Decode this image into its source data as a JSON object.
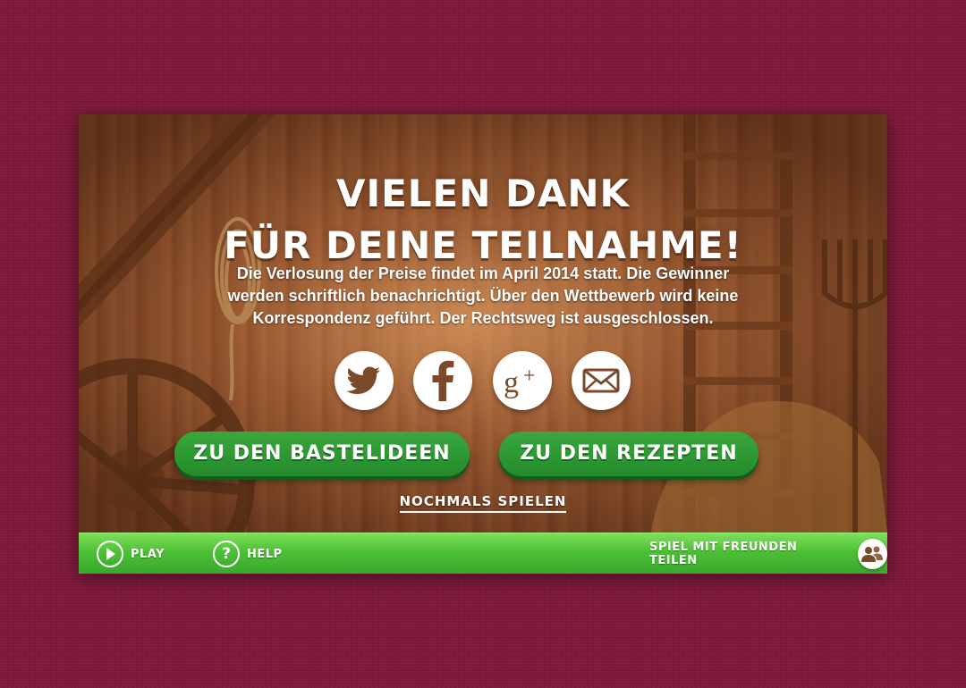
{
  "headline": {
    "line1": "VIELEN DANK",
    "line2": "FÜR DEINE TEILNAHME!"
  },
  "description": {
    "line1": "Die Verlosung der Preise findet im April 2014 statt. Die Gewinner",
    "line2": "werden schriftlich benachrichtigt. Über den Wettbewerb wird keine",
    "line3": "Korrespondenz geführt. Der Rechtsweg ist ausgeschlossen."
  },
  "social": {
    "icons": [
      "twitter-icon",
      "facebook-icon",
      "google-plus-icon",
      "mail-icon"
    ]
  },
  "buttons": {
    "crafts": "ZU DEN BASTELIDEEN",
    "recipes": "ZU DEN REZEPTEN",
    "play_again": "NOCHMALS SPIELEN"
  },
  "bottom_bar": {
    "play": "PLAY",
    "help": "HELP",
    "share": "SPIEL MIT FREUNDEN TEILEN"
  },
  "colors": {
    "page_background": "#7d1738",
    "button_green": "#2e9a35",
    "bar_green": "#4cbf36",
    "wood": "#8a4e2b"
  }
}
